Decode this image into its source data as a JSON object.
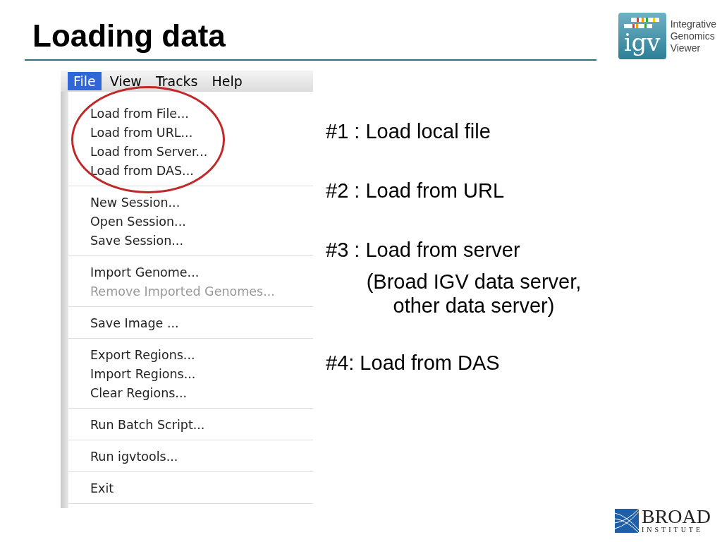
{
  "slide": {
    "title": "Loading data"
  },
  "logo": {
    "mark": "igv",
    "lines": [
      "Integrative",
      "Genomics",
      "Viewer"
    ]
  },
  "menu": {
    "bar": [
      {
        "label": "File",
        "selected": true
      },
      {
        "label": "View",
        "selected": false
      },
      {
        "label": "Tracks",
        "selected": false
      },
      {
        "label": "Help",
        "selected": false
      }
    ],
    "groups": [
      {
        "circled": true,
        "items": [
          {
            "label": "Load from File...",
            "disabled": false
          },
          {
            "label": "Load from URL...",
            "disabled": false
          },
          {
            "label": "Load from Server...",
            "disabled": false
          },
          {
            "label": "Load from DAS...",
            "disabled": false
          }
        ]
      },
      {
        "circled": false,
        "items": [
          {
            "label": "New Session...",
            "disabled": false
          },
          {
            "label": "Open Session...",
            "disabled": false
          },
          {
            "label": "Save Session...",
            "disabled": false
          }
        ]
      },
      {
        "circled": false,
        "items": [
          {
            "label": "Import Genome...",
            "disabled": false
          },
          {
            "label": "Remove Imported Genomes...",
            "disabled": true
          }
        ]
      },
      {
        "circled": false,
        "items": [
          {
            "label": "Save Image ...",
            "disabled": false
          }
        ]
      },
      {
        "circled": false,
        "items": [
          {
            "label": "Export Regions...",
            "disabled": false
          },
          {
            "label": "Import Regions...",
            "disabled": false
          },
          {
            "label": "Clear Regions...",
            "disabled": false
          }
        ]
      },
      {
        "circled": false,
        "items": [
          {
            "label": "Run Batch Script...",
            "disabled": false
          }
        ]
      },
      {
        "circled": false,
        "items": [
          {
            "label": "Run igvtools...",
            "disabled": false
          }
        ]
      },
      {
        "circled": false,
        "items": [
          {
            "label": "Exit",
            "disabled": false
          }
        ]
      }
    ]
  },
  "points": [
    {
      "kind": "point",
      "text": "#1 : Load local file"
    },
    {
      "kind": "point",
      "text": "#2 : Load from URL"
    },
    {
      "kind": "point",
      "text": "#3 : Load from server"
    },
    {
      "kind": "note",
      "lines": [
        "(Broad IGV data server,",
        "other data server)"
      ]
    },
    {
      "kind": "point",
      "text": "#4: Load from DAS"
    }
  ],
  "footer_logo": {
    "name": "BROAD",
    "sub": "INSTITUTE"
  }
}
